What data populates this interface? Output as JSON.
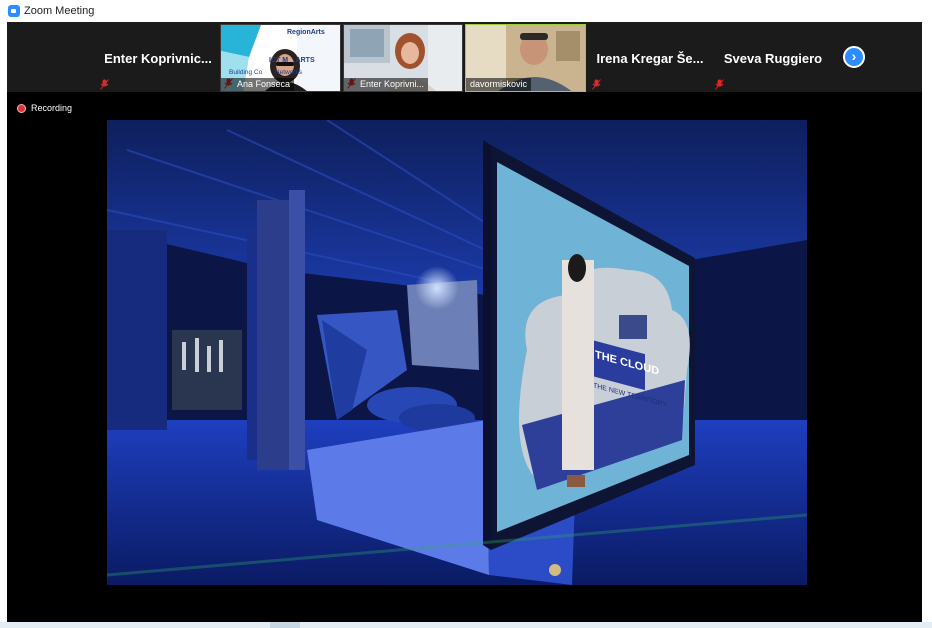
{
  "window": {
    "title": "Zoom Meeting",
    "icon": "zoom-icon"
  },
  "gallery": {
    "participants": [
      {
        "display": "Enter  Koprivnic...",
        "type": "name",
        "mic_muted": true
      },
      {
        "display": "Ana Fonseca",
        "type": "video",
        "mic_muted": true,
        "overlay_text": [
          "RegionArts",
          "ICT M    ARTS",
          "Building Co       Networks"
        ]
      },
      {
        "display": "Enter Koprivni...",
        "type": "video",
        "mic_muted": true
      },
      {
        "display": "davormiskovic",
        "type": "video",
        "mic_muted": false,
        "speaking": true
      },
      {
        "display": "Irena Kregar Še...",
        "type": "name",
        "mic_muted": true
      },
      {
        "display": "Sveva Ruggiero",
        "type": "name",
        "mic_muted": true
      }
    ],
    "next_page_icon": "chevron-right-icon"
  },
  "recording": {
    "label": "Recording",
    "color": "#e0323c"
  },
  "shared_screen": {
    "screen_sign_text": "THE CLOUD",
    "screen_subtext": "THE NEW TERRITORY"
  },
  "colors": {
    "accent": "#2d8cff",
    "speaking_border": "#9ccc3a",
    "meeting_bg": "#000000",
    "gallery_bg": "#1b1b1b"
  }
}
